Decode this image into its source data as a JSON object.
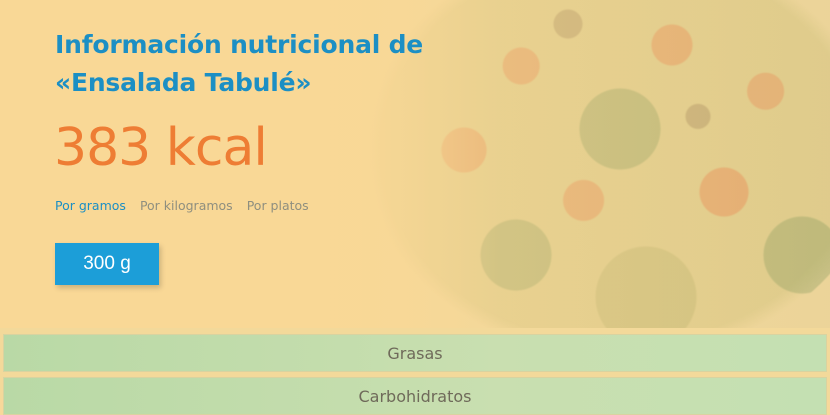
{
  "header": {
    "title": "Información nutricional de «Ensalada Tabulé»",
    "calories": "383 kcal"
  },
  "units": {
    "tabs": [
      {
        "label": "Por gramos",
        "active": true
      },
      {
        "label": "Por kilogramos",
        "active": false
      },
      {
        "label": "Por platos",
        "active": false
      }
    ],
    "quantity": "300 g"
  },
  "accordion": {
    "items": [
      {
        "label": "Grasas"
      },
      {
        "label": "Carbohidratos"
      }
    ]
  },
  "colors": {
    "accent": "#1c8fc4",
    "calories": "#ee7d34",
    "button": "#1c9ed8"
  }
}
